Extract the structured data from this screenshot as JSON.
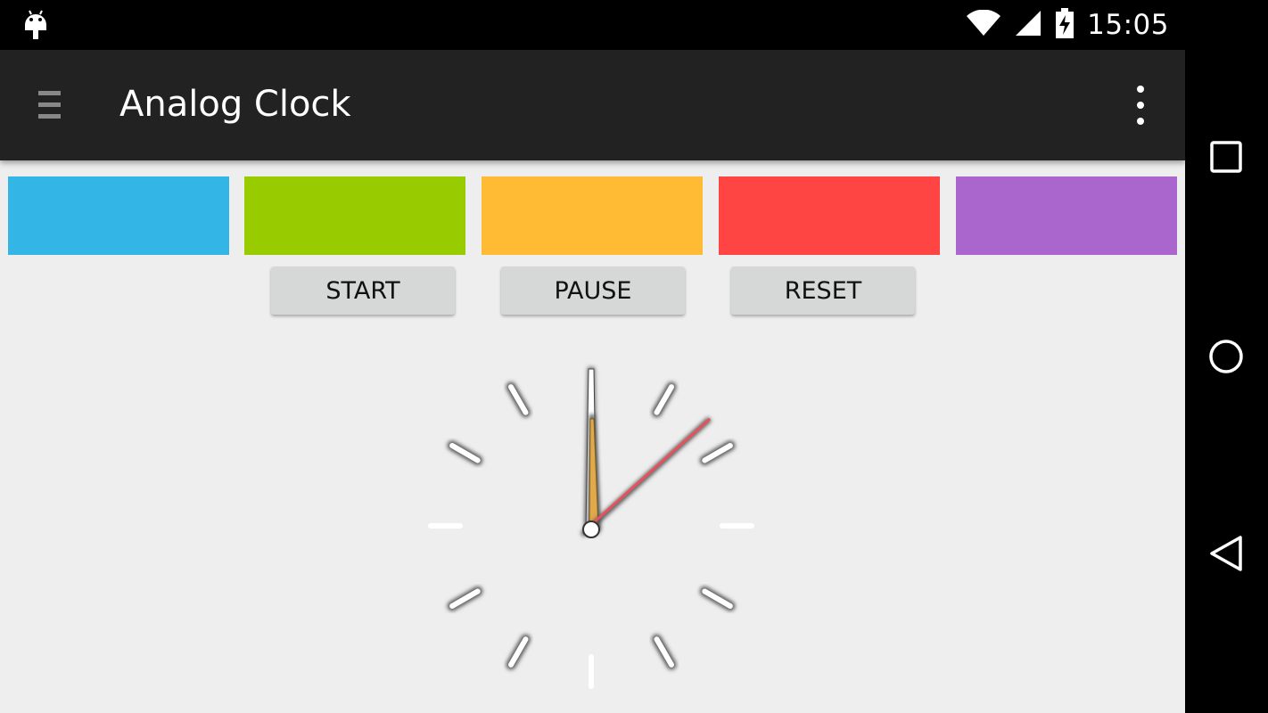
{
  "status_bar": {
    "time": "15:05",
    "icons": [
      "android-debug-icon",
      "wifi-icon",
      "cell-signal-icon",
      "battery-charging-icon"
    ]
  },
  "app_bar": {
    "title": "Analog Clock",
    "icons": [
      "menu-icon",
      "overflow-menu-icon"
    ]
  },
  "swatches": [
    {
      "name": "blue",
      "color": "#33b5e5"
    },
    {
      "name": "green",
      "color": "#99cc00"
    },
    {
      "name": "orange",
      "color": "#ffbb33"
    },
    {
      "name": "red",
      "color": "#ff4444"
    },
    {
      "name": "purple",
      "color": "#aa66cc"
    }
  ],
  "buttons": {
    "start": "START",
    "pause": "PAUSE",
    "reset": "RESET"
  },
  "clock": {
    "hands_color_second": "#e8505b",
    "hour_hand_color": "#e0a94a"
  },
  "nav_bar": {
    "icons": [
      "recent-apps-icon",
      "home-icon",
      "back-icon"
    ]
  }
}
